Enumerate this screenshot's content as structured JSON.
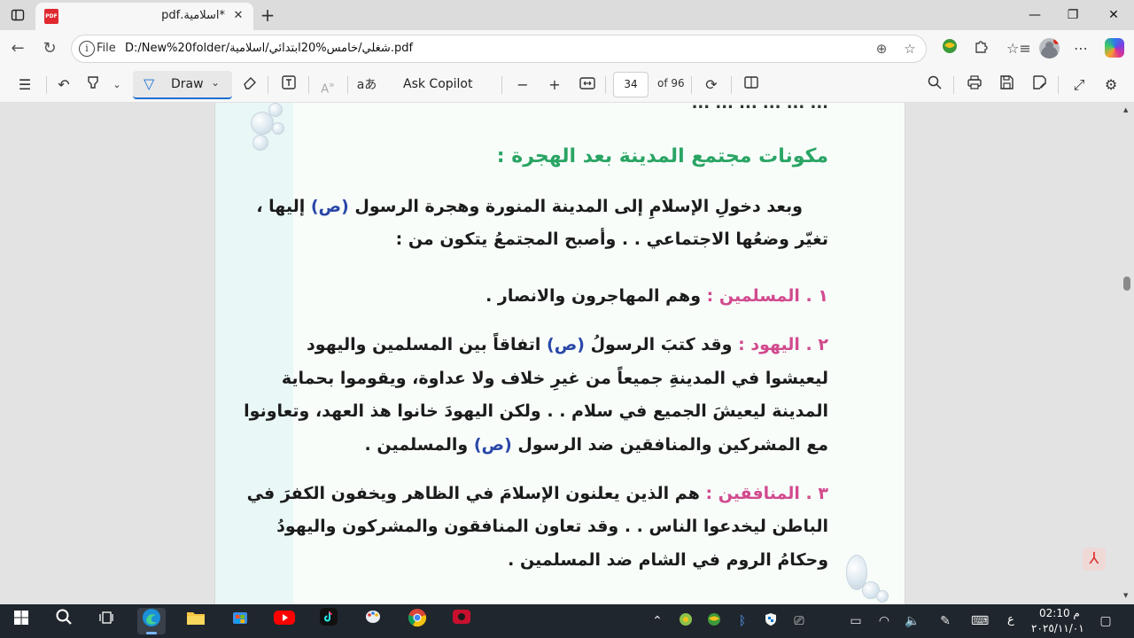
{
  "tab": {
    "title": "*اسلامية.pdf",
    "close": "✕",
    "new_tab": "+"
  },
  "window": {
    "minimize": "—",
    "restore": "❐",
    "close": "✕"
  },
  "address": {
    "file_label": "File",
    "url": "D:/New%20folder/شغلي/خامس%20ابتدائي/اسلامية.pdf"
  },
  "pdf_toolbar": {
    "draw_label": "Draw",
    "ask_label": "Ask Copilot",
    "translate_glyph": "aあ",
    "current_page": "34",
    "total_pages": "of 96"
  },
  "document": {
    "top_cut_line": "... ... ... ... ... ...",
    "heading": "مكونات مجتمع المدينة بعد الهجرة :",
    "intro_line1_a": "وبعد دخولِ الإسلامِ إلى المدينة المنورة وهجرة الرسول ",
    "pbuh": "(ص)",
    "intro_line1_b": " إليها ،",
    "intro_line2": "تغيّر وضعُها الاجتماعي . . وأصبح المجتمعُ يتكون من :",
    "item1_label": "١ . المسلمين :",
    "item1_text": " وهم المهاجرون والانصار .",
    "item2_label": "٢ . اليهود :",
    "item2_line1_a": " وقد كتبَ الرسولُ ",
    "item2_line1_b": " اتفاقاً بين المسلمين واليهود",
    "item2_line2": "ليعيشوا في المدينةِ جميعاً من غيرِ خلاف ولا عداوة، ويقوموا بحماية",
    "item2_line3": "المدينة ليعيشَ الجميع في سلام . . ولكن اليهودَ خانوا هذ العهد، وتعاونوا",
    "item2_line4_a": "مع المشركين والمنافقين ضد الرسول ",
    "item2_line4_b": " والمسلمين .",
    "item3_label": "٣ . المنافقين :",
    "item3_line1": " هم الذين يعلنون الإسلامَ في الظاهر ويخفون الكفرَ في",
    "item3_line2": "الباطن ليخدعوا الناس . . وقد تعاون المنافقون والمشركون واليهودُ",
    "item3_line3": "وحكامُ الروم في الشام ضد المسلمين ."
  },
  "colors": {
    "heading": "#2aa564",
    "label_pink": "#d24a8e",
    "pbuh_blue": "#2a47a8",
    "accent": "#1a6fd1"
  },
  "taskbar": {
    "lang": "ع",
    "time": "م 02:10",
    "date": "٢٠٢٥/١١/٠١"
  }
}
